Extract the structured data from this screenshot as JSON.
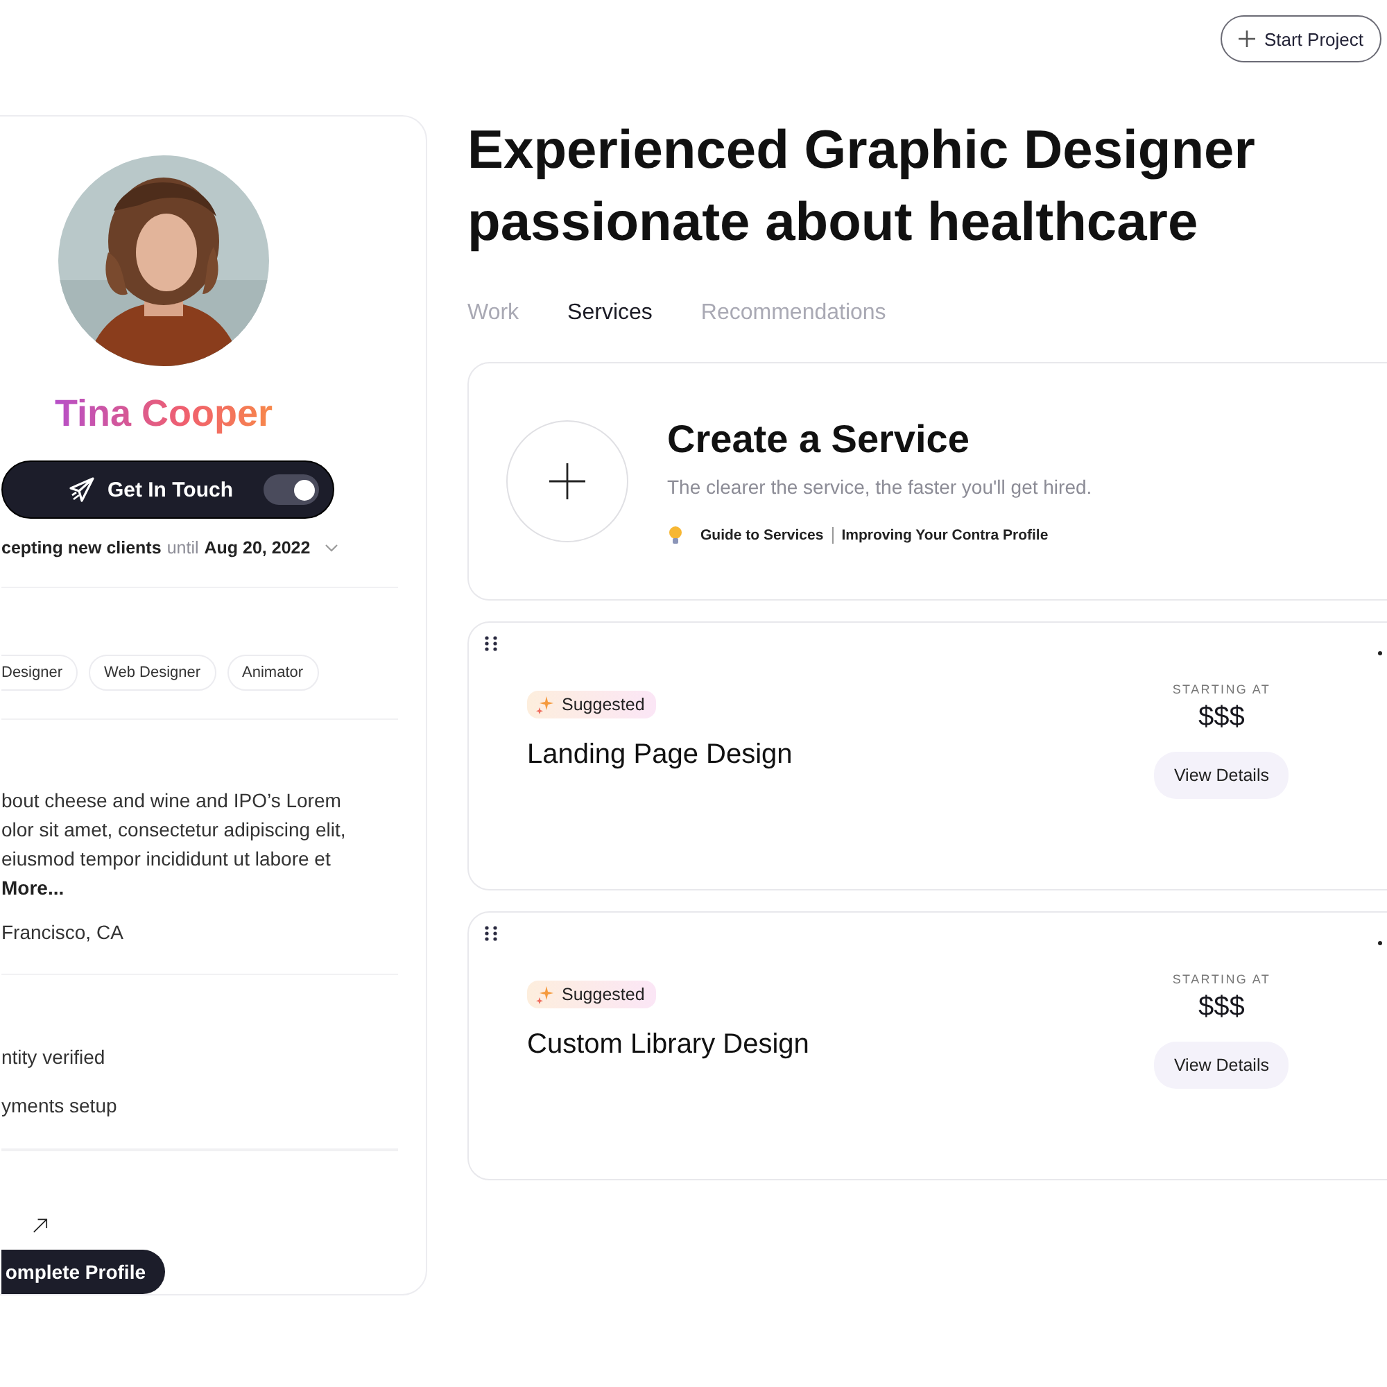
{
  "header": {
    "start_project": "Start Project"
  },
  "profile": {
    "avatar": {
      "kind": "picture"
    },
    "name": "Tina Cooper",
    "contact_button": "Get In Touch",
    "available_toggle": {
      "on": true
    },
    "availability": {
      "status": "cepting new clients",
      "until": "until",
      "date": "Aug 20, 2022"
    },
    "skills": [
      "Designer",
      "Web Designer",
      "Animator"
    ],
    "bio_lines": [
      "bout cheese and wine and IPO’s Lorem",
      "olor sit amet, consectetur adipiscing elit,",
      "eiusmod tempor incididunt ut labore et"
    ],
    "more_link": "More...",
    "location": "Francisco, CA",
    "verifications": [
      "ntity verified",
      "yments setup"
    ],
    "complete_button": "omplete Profile"
  },
  "headline": "Experienced Graphic Designer passionate about healthcare",
  "tabs": [
    {
      "label": "Work",
      "selected": false
    },
    {
      "label": "Services",
      "selected": true
    },
    {
      "label": "Recommendations",
      "selected": false
    }
  ],
  "create_service": {
    "title": "Create a Service",
    "subtitle": "The clearer the service, the faster you'll get hired.",
    "links": [
      "Guide to Services",
      "Improving Your Contra Profile"
    ]
  },
  "services": [
    {
      "badge": "Suggested",
      "title": "Landing Page Design",
      "price_label": "STARTING AT",
      "price": "$$$",
      "button": "View Details"
    },
    {
      "badge": "Suggested",
      "title": "Custom Library Design",
      "price_label": "STARTING AT",
      "price": "$$$",
      "button": "View Details"
    }
  ]
}
